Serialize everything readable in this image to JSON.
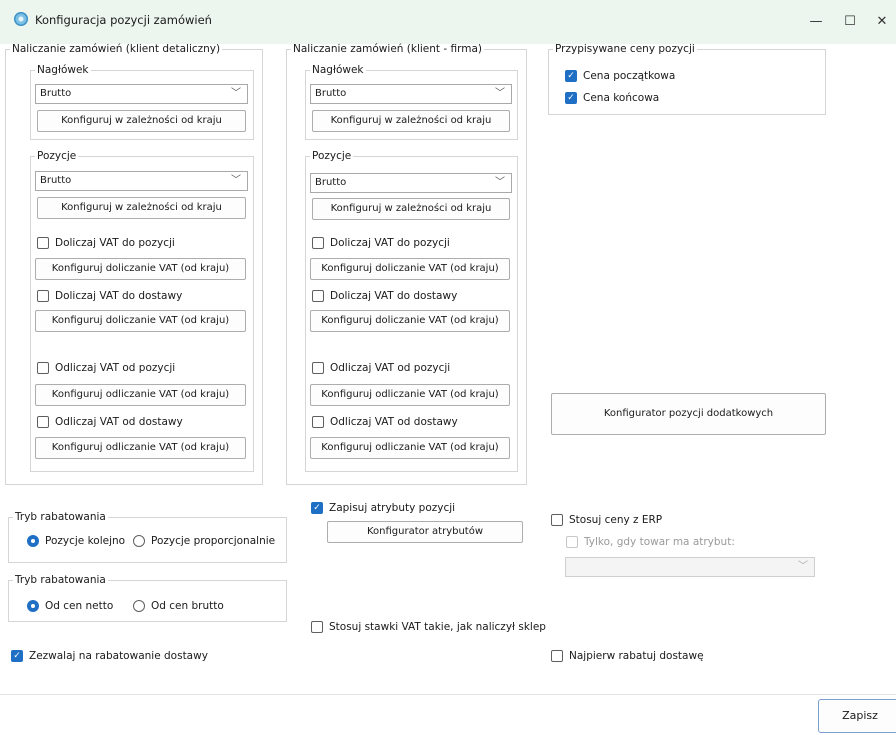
{
  "window": {
    "title": "Konfiguracja pozycji zamówień",
    "minimize": "—",
    "maximize": "☐",
    "close": "✕"
  },
  "retail": {
    "legend": "Naliczanie zamówień (klient detaliczny)",
    "header": {
      "legend": "Nagłówek",
      "select": "Brutto",
      "button": "Konfiguruj w zależności od kraju"
    },
    "positions": {
      "legend": "Pozycje",
      "select": "Brutto",
      "button": "Konfiguruj w zależności od kraju",
      "add_vat_positions": "Doliczaj VAT do pozycji",
      "add_vat_positions_btn": "Konfiguruj doliczanie VAT (od kraju)",
      "add_vat_delivery": "Doliczaj VAT do dostawy",
      "add_vat_delivery_btn": "Konfiguruj doliczanie VAT (od kraju)",
      "sub_vat_positions": "Odliczaj VAT od pozycji",
      "sub_vat_positions_btn": "Konfiguruj odliczanie VAT (od kraju)",
      "sub_vat_delivery": "Odliczaj VAT od dostawy",
      "sub_vat_delivery_btn": "Konfiguruj odliczanie VAT (od kraju)"
    }
  },
  "company": {
    "legend": "Naliczanie zamówień (klient - firma)",
    "header": {
      "legend": "Nagłówek",
      "select": "Brutto",
      "button": "Konfiguruj w zależności od kraju"
    },
    "positions": {
      "legend": "Pozycje",
      "select": "Brutto",
      "button": "Konfiguruj w zależności od kraju",
      "add_vat_positions": "Doliczaj VAT do pozycji",
      "add_vat_positions_btn": "Konfiguruj doliczanie VAT (od kraju)",
      "add_vat_delivery": "Doliczaj VAT do dostawy",
      "add_vat_delivery_btn": "Konfiguruj doliczanie VAT (od kraju)",
      "sub_vat_positions": "Odliczaj VAT od pozycji",
      "sub_vat_positions_btn": "Konfiguruj odliczanie VAT (od kraju)",
      "sub_vat_delivery": "Odliczaj VAT od dostawy",
      "sub_vat_delivery_btn": "Konfiguruj odliczanie VAT (od kraju)"
    }
  },
  "prices": {
    "legend": "Przypisywane ceny pozycji",
    "initial": "Cena początkowa",
    "final": "Cena końcowa"
  },
  "extra_button": "Konfigurator pozycji dodatkowych",
  "discount_mode1": {
    "legend": "Tryb rabatowania",
    "opt1": "Pozycje kolejno",
    "opt2": "Pozycje proporcjonalnie"
  },
  "discount_mode2": {
    "legend": "Tryb rabatowania",
    "opt1": "Od cen netto",
    "opt2": "Od cen brutto"
  },
  "attributes": {
    "save": "Zapisuj atrybuty pozycji",
    "button": "Konfigurator atrybutów"
  },
  "erp": {
    "use_prices": "Stosuj ceny z ERP",
    "only_if": "Tylko, gdy towar ma atrybut:",
    "select": ""
  },
  "vat_rates": "Stosuj stawki VAT takie, jak naliczył sklep",
  "allow_delivery_discount": "Zezwalaj na rabatowanie dostawy",
  "discount_delivery_first": "Najpierw rabatuj dostawę",
  "save_button": "Zapisz"
}
